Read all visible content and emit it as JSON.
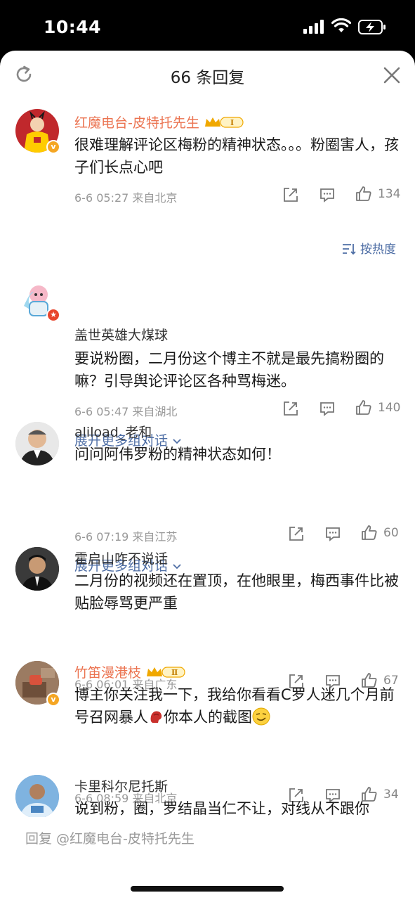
{
  "status_bar": {
    "time": "10:44"
  },
  "sheet": {
    "title": "66 条回复"
  },
  "sort": {
    "label": "按热度"
  },
  "comments": [
    {
      "username": "红魔电台-皮特托先生",
      "text": "很难理解评论区梅粉的精神状态。。。粉圈害人，孩子们长点心吧",
      "time": "6-6 05:27",
      "location": "来自北京",
      "likes": "134",
      "badge": "Ⅰ"
    },
    {
      "username": "盖世英雄大煤球",
      "text": "要说粉圈，二月份这个博主不就是最先搞粉圈的嘛？引导舆论评论区各种骂梅迷。",
      "time": "6-6 05:47",
      "location": "来自湖北",
      "likes": "140",
      "expand": "展开更多组对话"
    },
    {
      "username": "aliload_老和",
      "text": "问问阿伟罗粉的精神状态如何！",
      "time": "6-6 07:19",
      "location": "来自江苏",
      "likes": "60",
      "expand": "展开更多组对话"
    },
    {
      "username": "霍启山咋不说话",
      "text": "二月份的视频还在置顶，在他眼里，梅西事件比被贴脸辱骂更严重",
      "time": "6-6 06:01",
      "location": "来自广东",
      "likes": "67"
    },
    {
      "username": "竹笛漫港枝",
      "text_before": "博主你关注我一下，我给你看看C罗人迷几个月前号召网暴人",
      "text_mid": "你本人的截图",
      "time": "6-6 08:59",
      "location": "来自北京",
      "likes": "34",
      "badge": "Ⅱ"
    },
    {
      "username": "卡里科尔尼托斯",
      "text": "说到粉，圈，罗结晶当仁不让，对线从不跟你"
    }
  ],
  "reply_bar": {
    "placeholder": "回复 @红魔电台-皮特托先生"
  },
  "colors": {
    "link": "#4e6ea5",
    "vip_name": "#eb7350",
    "meta": "#999999"
  }
}
